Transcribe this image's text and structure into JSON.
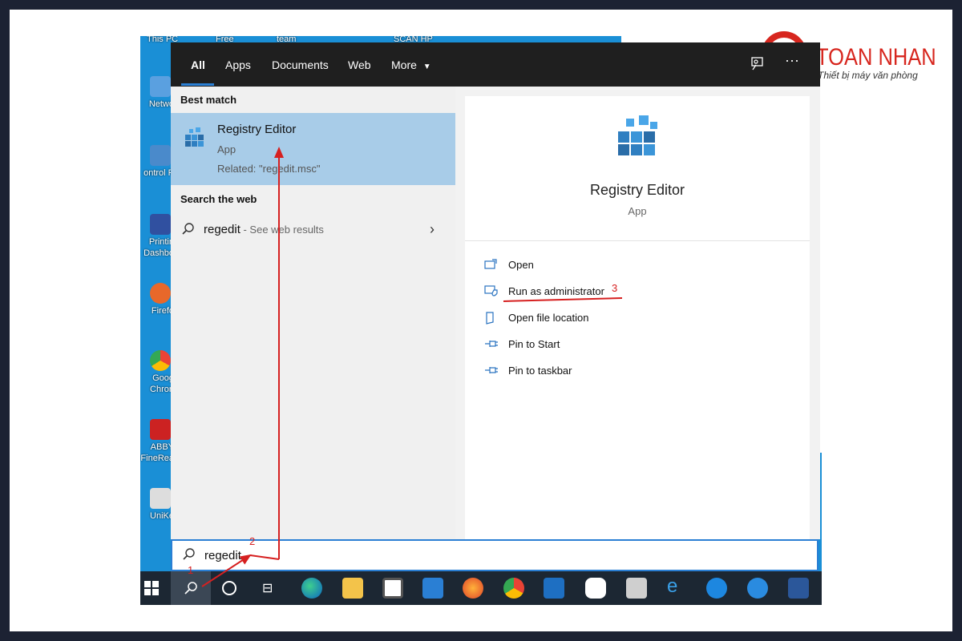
{
  "desktop": {
    "top_labels": [
      "This PC",
      "Free",
      "team",
      "SCAN HP"
    ],
    "icons": [
      {
        "label": "Netwo",
        "color": "#5aa0e0"
      },
      {
        "label": "ontrol P",
        "color": "#4a8acb"
      },
      {
        "label": "Printin Dashbo",
        "color": "#3050a0"
      },
      {
        "label": "Firefo",
        "color": "#e8682a"
      },
      {
        "label": "Goog Chron",
        "color": "#34a853"
      },
      {
        "label": "ABBY FineRea",
        "color": "#cc2222"
      },
      {
        "label": "UniKe",
        "color": "#dddddd"
      }
    ]
  },
  "logo": {
    "name": "TOAN NHAN",
    "tagline": "Thiết bị máy văn phòng",
    "color": "#d7261e"
  },
  "tabs": [
    "All",
    "Apps",
    "Documents",
    "Web",
    "More"
  ],
  "topbar_icons": [
    "feedback-icon",
    "more-options-icon"
  ],
  "left": {
    "best_match_title": "Best match",
    "best_match": {
      "name": "Registry Editor",
      "type": "App",
      "related": "Related: \"regedit.msc\""
    },
    "search_web_title": "Search the web",
    "web_result": {
      "query": "regedit",
      "suffix": " - See web results"
    }
  },
  "right": {
    "title": "Registry Editor",
    "subtitle": "App",
    "actions": [
      {
        "label": "Open",
        "icon": "open-icon"
      },
      {
        "label": "Run as administrator",
        "icon": "shield-icon"
      },
      {
        "label": "Open file location",
        "icon": "folder-icon"
      },
      {
        "label": "Pin to Start",
        "icon": "pin-icon"
      },
      {
        "label": "Pin to taskbar",
        "icon": "pin-icon"
      }
    ]
  },
  "searchbox": {
    "value": "regedit"
  },
  "annotations": {
    "step1": "1",
    "step2": "2",
    "step3": "3",
    "color": "#d62020"
  },
  "taskbar_icons": [
    "windows-start-icon",
    "search-icon",
    "cortana-icon",
    "task-view-icon",
    "edge-icon",
    "file-explorer-icon",
    "store-icon",
    "mail-icon",
    "firefox-icon",
    "chrome-icon",
    "trello-icon",
    "zalo-icon",
    "scanner-icon",
    "internet-explorer-icon",
    "teamviewer-icon",
    "remote-icon",
    "word-icon"
  ]
}
